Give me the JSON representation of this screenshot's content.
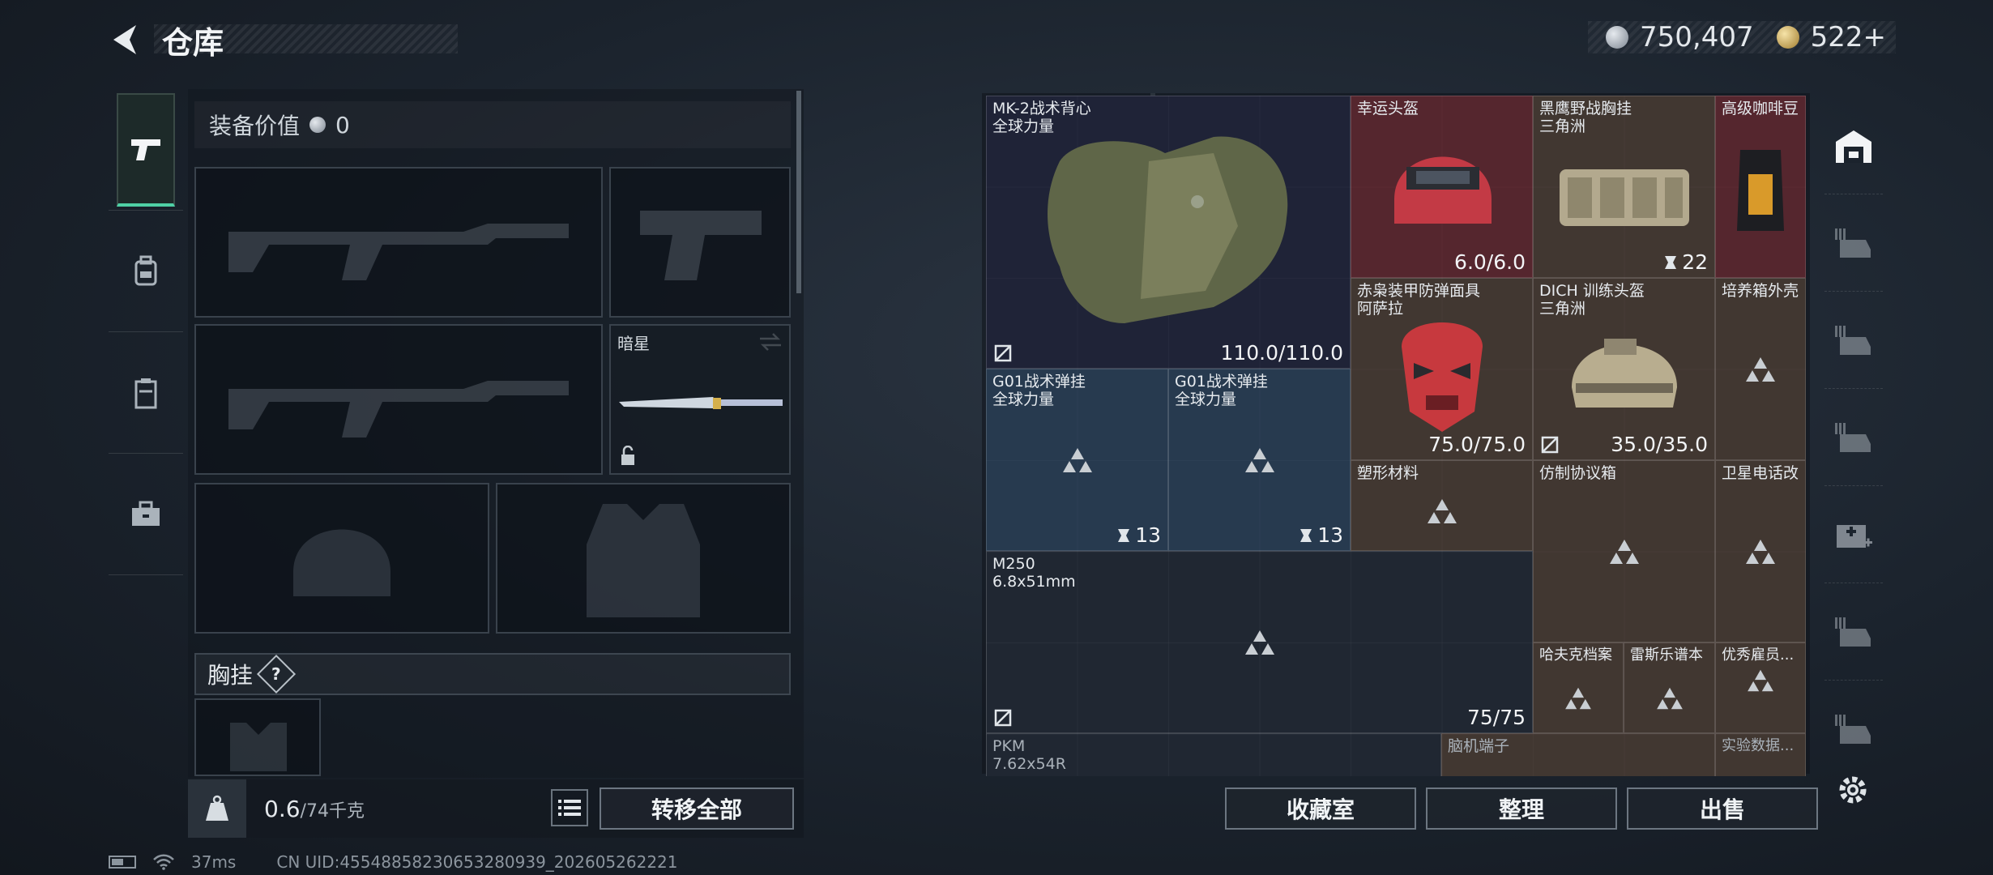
{
  "header": {
    "title": "仓库",
    "currency": [
      {
        "icon": "silver-coin-icon",
        "value": "750,407"
      },
      {
        "icon": "gold-coin-icon",
        "value": "522+"
      }
    ]
  },
  "left_tabs": [
    {
      "icon": "pistol-icon",
      "active": true
    },
    {
      "icon": "backpack-icon",
      "active": false
    },
    {
      "icon": "locker-icon",
      "active": false
    },
    {
      "icon": "toolbox-icon",
      "active": false
    }
  ],
  "equipment": {
    "value_label": "装备价值",
    "value": "0",
    "melee_label": "暗星",
    "chest_rig_label": "胸挂",
    "chest_rig_help": "?"
  },
  "weight": {
    "current": "0.6",
    "capacity": "/74千克"
  },
  "buttons": {
    "transfer_all": "转移全部",
    "collection": "收藏室",
    "sort": "整理",
    "sell": "出售"
  },
  "items": [
    {
      "name": "MK-2战术背心",
      "sub": "全球力量",
      "value": "110.0/110.0",
      "color": "dark"
    },
    {
      "name": "幸运头盔",
      "sub": "",
      "value": "6.0/6.0",
      "color": "red"
    },
    {
      "name": "黑鹰野战胸挂",
      "sub": "三角洲",
      "value": "22",
      "color": "brown"
    },
    {
      "name": "高级咖啡豆",
      "sub": "",
      "value": "",
      "color": "red"
    },
    {
      "name": "赤枭装甲防弹面具",
      "sub": "阿萨拉",
      "value": "75.0/75.0",
      "color": "brown"
    },
    {
      "name": "DICH 训练头盔",
      "sub": "三角洲",
      "value": "35.0/35.0",
      "color": "brown"
    },
    {
      "name": "培养箱外壳",
      "sub": "",
      "value": "",
      "color": "brown"
    },
    {
      "name": "G01战术弹挂",
      "sub": "全球力量",
      "value": "13",
      "color": "blue"
    },
    {
      "name": "G01战术弹挂",
      "sub": "全球力量",
      "value": "13",
      "color": "blue"
    },
    {
      "name": "塑形材料",
      "sub": "",
      "value": "",
      "color": "brown"
    },
    {
      "name": "仿制协议箱",
      "sub": "",
      "value": "",
      "color": "brown"
    },
    {
      "name": "卫星电话改",
      "sub": "",
      "value": "",
      "color": "brown"
    },
    {
      "name": "M250",
      "sub": "6.8x51mm",
      "value": "75/75",
      "color": "grey"
    },
    {
      "name": "哈夫克档案",
      "sub": "",
      "value": "",
      "color": "brown"
    },
    {
      "name": "雷斯乐谱本",
      "sub": "",
      "value": "",
      "color": "brown"
    },
    {
      "name": "优秀雇员...",
      "sub": "",
      "value": "",
      "color": "brown"
    },
    {
      "name": "PKM",
      "sub": "7.62x54R",
      "value": "",
      "color": "grey"
    },
    {
      "name": "脑机端子",
      "sub": "",
      "value": "",
      "color": "brown"
    },
    {
      "name": "实验数据...",
      "sub": "",
      "value": "",
      "color": "brown"
    }
  ],
  "right_rail": [
    {
      "icon": "warehouse-icon",
      "active": true
    },
    {
      "icon": "storage-slot-icon"
    },
    {
      "icon": "storage-slot-icon"
    },
    {
      "icon": "storage-slot-icon"
    },
    {
      "icon": "medical-storage-icon"
    },
    {
      "icon": "storage-slot-icon"
    },
    {
      "icon": "storage-slot-icon"
    }
  ],
  "status_bar": {
    "ping": "37ms",
    "uid": "CN UID:4554885823065328093​9_202605262221"
  }
}
